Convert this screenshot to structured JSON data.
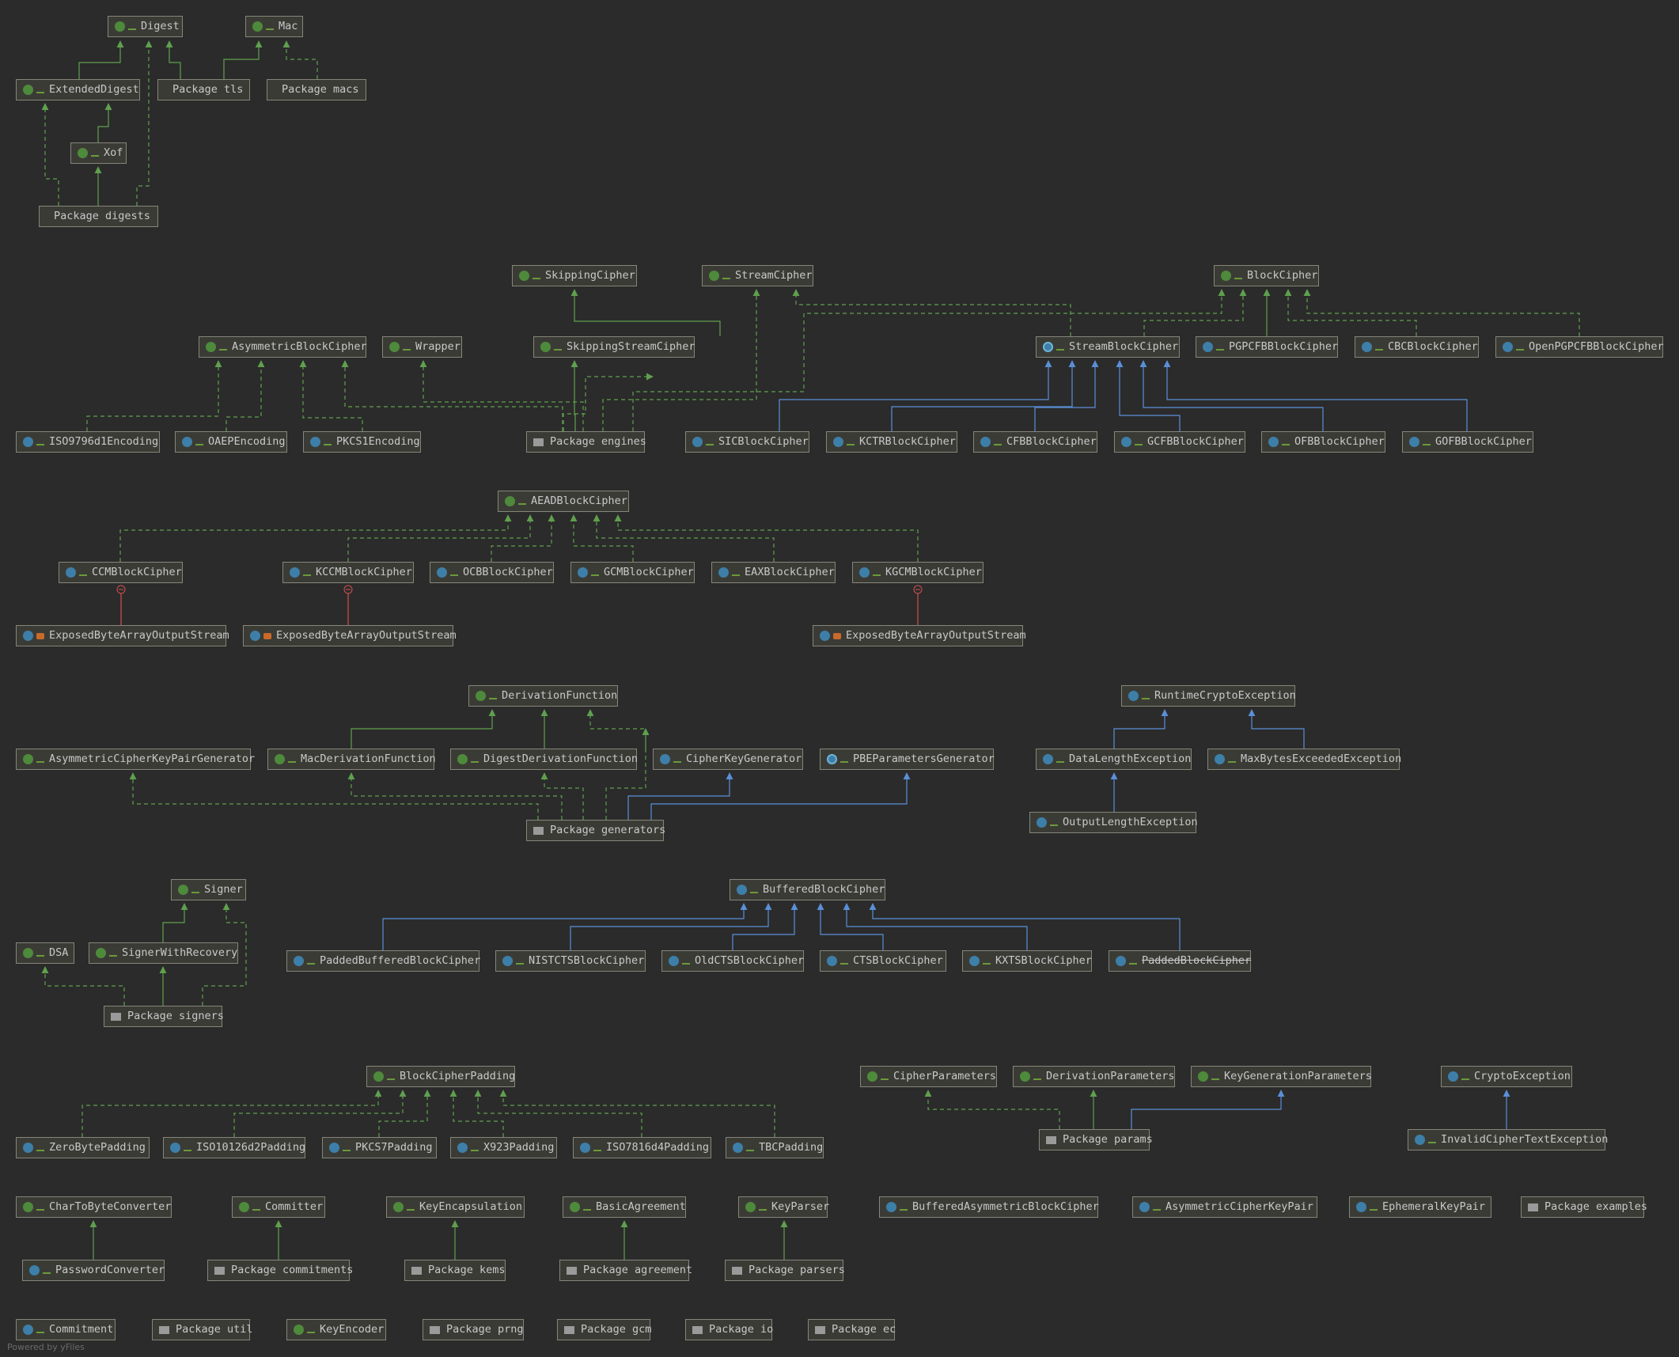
{
  "colors": {
    "background": "#2b2b2b",
    "node_fill": "#3b3b36",
    "node_border": "#85857a",
    "interface_edge": "#5fa04e",
    "class_edge": "#5a8fd8",
    "inner_edge": "#d0504f"
  },
  "nodes": {
    "digest": "Digest",
    "mac": "Mac",
    "extended_digest": "ExtendedDigest",
    "pkg_tls": "Package tls",
    "pkg_macs": "Package macs",
    "xof": "Xof",
    "pkg_digests": "Package digests",
    "skipping_cipher": "SkippingCipher",
    "stream_cipher": "StreamCipher",
    "block_cipher": "BlockCipher",
    "asymmetric_block_cipher": "AsymmetricBlockCipher",
    "wrapper": "Wrapper",
    "skipping_stream_cipher": "SkippingStreamCipher",
    "stream_block_cipher": "StreamBlockCipher",
    "pgpcfb_block_cipher": "PGPCFBBlockCipher",
    "cbc_block_cipher": "CBCBlockCipher",
    "openpgpcfb_block_cipher": "OpenPGPCFBBlockCipher",
    "iso9796d1_encoding": "ISO9796d1Encoding",
    "oaep_encoding": "OAEPEncoding",
    "pkcs1_encoding": "PKCS1Encoding",
    "pkg_engines": "Package engines",
    "sic_block_cipher": "SICBlockCipher",
    "kctr_block_cipher": "KCTRBlockCipher",
    "cfb_block_cipher": "CFBBlockCipher",
    "gcfb_block_cipher": "GCFBBlockCipher",
    "ofb_block_cipher": "OFBBlockCipher",
    "gofb_block_cipher": "GOFBBlockCipher",
    "aead_block_cipher": "AEADBlockCipher",
    "ccm_block_cipher": "CCMBlockCipher",
    "kccm_block_cipher": "KCCMBlockCipher",
    "ocb_block_cipher": "OCBBlockCipher",
    "gcm_block_cipher": "GCMBlockCipher",
    "eax_block_cipher": "EAXBlockCipher",
    "kgcm_block_cipher": "KGCMBlockCipher",
    "exposed_baos_1": "ExposedByteArrayOutputStream",
    "exposed_baos_2": "ExposedByteArrayOutputStream",
    "exposed_baos_3": "ExposedByteArrayOutputStream",
    "derivation_function": "DerivationFunction",
    "runtime_crypto_exception": "RuntimeCryptoException",
    "asymmetric_cipher_key_pair_generator": "AsymmetricCipherKeyPairGenerator",
    "mac_derivation_function": "MacDerivationFunction",
    "digest_derivation_function": "DigestDerivationFunction",
    "cipher_key_generator": "CipherKeyGenerator",
    "pbe_parameters_generator": "PBEParametersGenerator",
    "data_length_exception": "DataLengthException",
    "max_bytes_exceeded_exception": "MaxBytesExceededException",
    "pkg_generators": "Package generators",
    "output_length_exception": "OutputLengthException",
    "signer": "Signer",
    "buffered_block_cipher": "BufferedBlockCipher",
    "dsa": "DSA",
    "signer_with_recovery": "SignerWithRecovery",
    "padded_buffered_block_cipher": "PaddedBufferedBlockCipher",
    "nistcts_block_cipher": "NISTCTSBlockCipher",
    "oldcts_block_cipher": "OldCTSBlockCipher",
    "cts_block_cipher": "CTSBlockCipher",
    "kxts_block_cipher": "KXTSBlockCipher",
    "padded_block_cipher": "PaddedBlockCipher",
    "pkg_signers": "Package signers",
    "block_cipher_padding": "BlockCipherPadding",
    "cipher_parameters": "CipherParameters",
    "derivation_parameters": "DerivationParameters",
    "key_generation_parameters": "KeyGenerationParameters",
    "crypto_exception": "CryptoException",
    "zero_byte_padding": "ZeroBytePadding",
    "iso10126d2_padding": "ISO10126d2Padding",
    "pkcs7_padding": "PKCS7Padding",
    "x923_padding": "X923Padding",
    "iso7816d4_padding": "ISO7816d4Padding",
    "tbc_padding": "TBCPadding",
    "pkg_params": "Package params",
    "invalid_cipher_text_exception": "InvalidCipherTextException",
    "char_to_byte_converter": "CharToByteConverter",
    "committer": "Committer",
    "key_encapsulation": "KeyEncapsulation",
    "basic_agreement": "BasicAgreement",
    "key_parser": "KeyParser",
    "buffered_asymmetric_block_cipher": "BufferedAsymmetricBlockCipher",
    "asymmetric_cipher_key_pair": "AsymmetricCipherKeyPair",
    "ephemeral_key_pair": "EphemeralKeyPair",
    "pkg_examples": "Package examples",
    "password_converter": "PasswordConverter",
    "pkg_commitments": "Package commitments",
    "pkg_kems": "Package kems",
    "pkg_agreement": "Package agreement",
    "pkg_parsers": "Package parsers",
    "commitment": "Commitment",
    "pkg_util": "Package util",
    "key_encoder": "KeyEncoder",
    "pkg_prng": "Package prng",
    "pkg_gcm": "Package gcm",
    "pkg_io": "Package io",
    "pkg_ec": "Package ec"
  },
  "footer": "Powered by yFiles"
}
